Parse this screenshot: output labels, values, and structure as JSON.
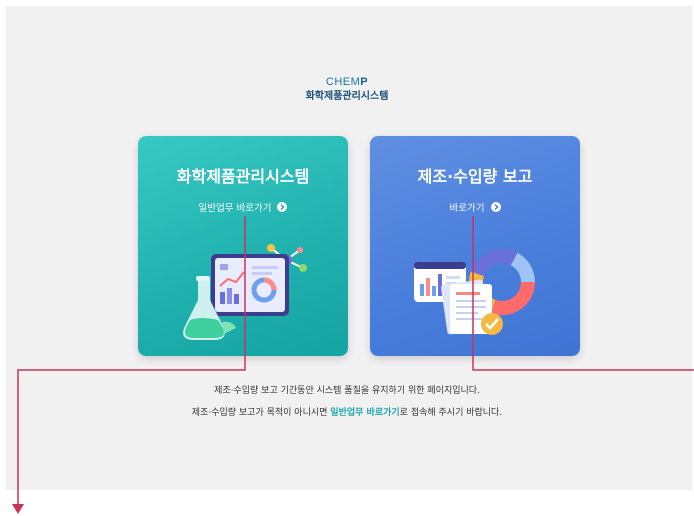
{
  "header": {
    "logo_text_prefix": "CHEM",
    "logo_text_suffix": "P",
    "system_name": "화학제품관리시스템"
  },
  "cards": [
    {
      "title": "화학제품관리시스템",
      "link": "일반업무 바로가기"
    },
    {
      "title": "제조·수입량 보고",
      "link": "바로가기"
    }
  ],
  "notice": {
    "line1": "제조·수입량 보고 기간동안 시스템 품질을 유지하기 위한 페이지입니다.",
    "line2_before": "제조·수입량 보고가 목적이 아니시면 ",
    "line2_highlight": "일반업무 바로가기",
    "line2_after": "로 접속해 주시기 바랍니다."
  },
  "colors": {
    "teal_card": "#22b4b1",
    "blue_card": "#4a7fdc",
    "annotation_line": "#c9325a",
    "highlight_text": "#1da8a8"
  }
}
